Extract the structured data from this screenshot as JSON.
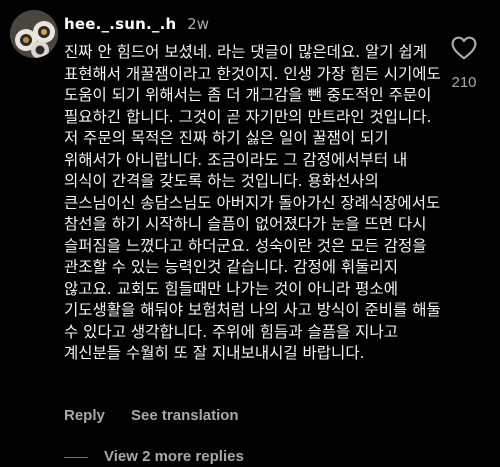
{
  "comment": {
    "username": "hee._.sun._.h",
    "timestamp": "2w",
    "text": "진짜 안 힘드어 보셨네. 라는 댓글이 많은데요. 알기 쉽게 표현해서 개꿀잼이라고 한것이지. 인생 가장 힘든 시기에도 도움이 되기 위해서는 좀 더 개그감을 뺀 중도적인 주문이 필요하긴 합니다. 그것이 곧 자기만의 만트라인 것입니다. 저 주문의 목적은 진짜 하기 싫은 일이 꿀잼이 되기 위해서가 아니랍니다. 조금이라도 그 감정에서부터 내 의식이 간격을 갖도록 하는 것입니다. 용화선사의 큰스님이신 송담스님도 아버지가 돌아가신 장례식장에서도 참선을 하기 시작하니 슬픔이 없어졌다가 눈을 뜨면 다시 슬퍼짐을 느꼈다고 하더군요. 성숙이란 것은 모든 감정을 관조할 수 있는 능력인것 같습니다. 감정에 휘둘리지 않고요. 교회도 힘들때만 나가는 것이 아니라 평소에 기도생활을 해둬야 보험처럼 나의 사고 방식이 준비를 해둘 수 있다고 생각합니다. 주위에 힘듬과 슬픔을 지나고 계신분들 수월히 또 잘 지내보내시길 바랍니다.",
    "like_count": "210",
    "like_icon": "heart-outline-icon"
  },
  "actions": {
    "reply_label": "Reply",
    "translate_label": "See translation"
  },
  "replies": {
    "label": "View 2 more replies"
  }
}
